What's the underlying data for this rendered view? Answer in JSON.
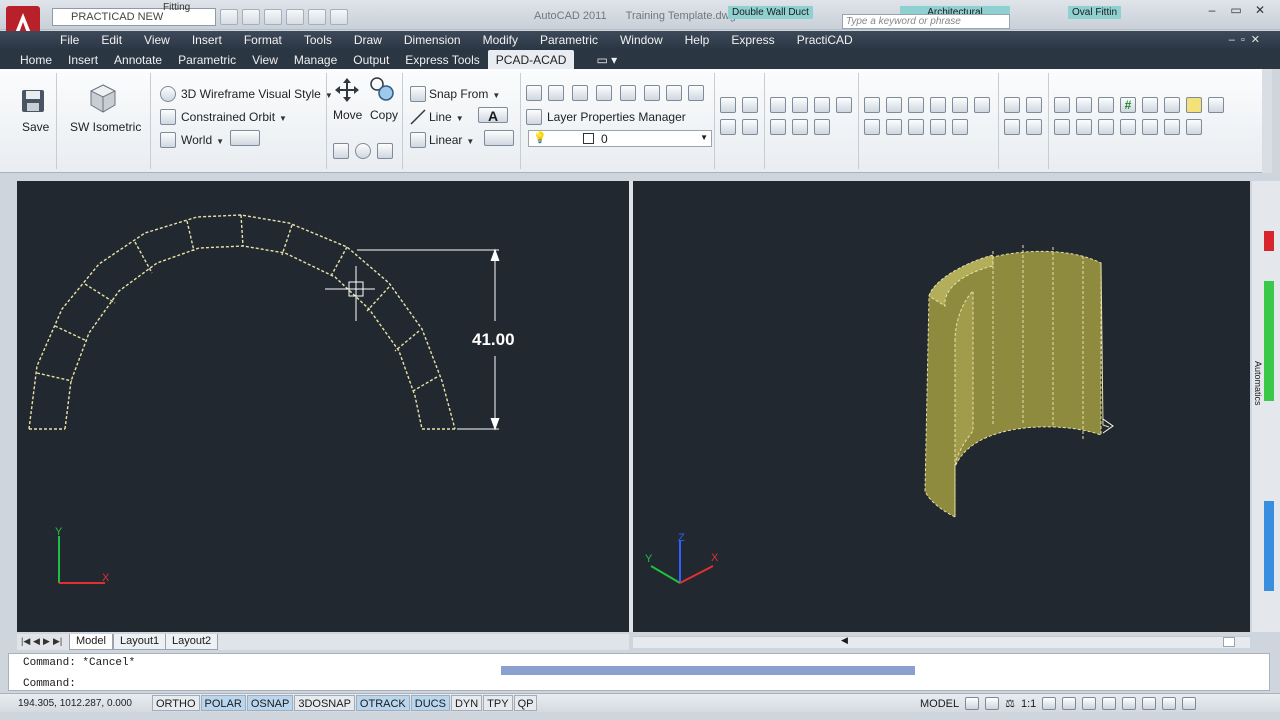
{
  "titlebar": {
    "workspace": "PRACTICAD NEW",
    "workspace_overlay": "Fitting",
    "app_title": "AutoCAD 2011",
    "file_title": "Training Template.dwg",
    "tag_double_wall": "Double Wall Duct",
    "tag_architectural": "Architectural",
    "tag_oval": "Oval Fittin",
    "search_placeholder": "Type a keyword or phrase"
  },
  "menu": [
    "File",
    "Edit",
    "View",
    "Insert",
    "Format",
    "Tools",
    "Draw",
    "Dimension",
    "Modify",
    "Parametric",
    "Window",
    "Help",
    "Express",
    "PractiCAD"
  ],
  "ribbon_tabs": [
    "Home",
    "Insert",
    "Annotate",
    "Parametric",
    "View",
    "Manage",
    "Output",
    "Express Tools",
    "PCAD-ACAD"
  ],
  "ribbon_active_tab": "PCAD-ACAD",
  "ribbon": {
    "save": "Save",
    "sw_isometric": "SW Isometric",
    "visual_style": "3D Wireframe Visual Style",
    "orbit": "Constrained Orbit",
    "ucs": "World",
    "move": "Move",
    "copy": "Copy",
    "snap_from": "Snap From",
    "line": "Line",
    "linear": "Linear",
    "layer_props": "Layer Properties Manager",
    "current_layer": "0"
  },
  "viewport": {
    "dimension_value": "41.00"
  },
  "layout_tabs": [
    "Model",
    "Layout1",
    "Layout2"
  ],
  "command": {
    "line1": "Command: *Cancel*",
    "line2": "Command:"
  },
  "status": {
    "coords": "194.305, 1012.287, 0.000",
    "toggles": [
      "ORTHO",
      "POLAR",
      "OSNAP",
      "3DOSNAP",
      "OTRACK",
      "DUCS",
      "DYN",
      "TPY",
      "QP"
    ],
    "model": "MODEL",
    "scale": "1:1"
  },
  "side_palette": {
    "automatics": "Automatics"
  }
}
